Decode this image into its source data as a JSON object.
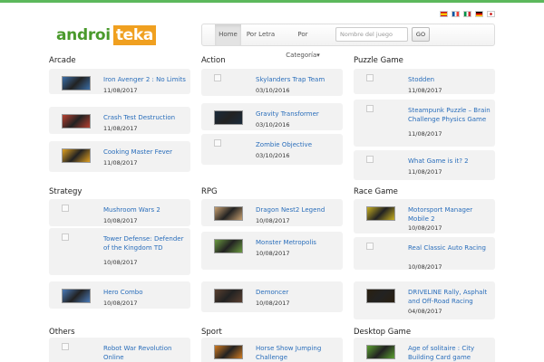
{
  "brand": {
    "part1": "androi",
    "part2": "teka"
  },
  "languages": [
    {
      "name": "Español",
      "icon": "flag-es-icon",
      "colors": [
        "#c60b1e",
        "#ffc400",
        "#c60b1e"
      ]
    },
    {
      "name": "Français",
      "icon": "flag-fr-icon",
      "colors": [
        "#0055a4",
        "#ffffff",
        "#ef4135"
      ]
    },
    {
      "name": "Italiano",
      "icon": "flag-it-icon",
      "colors": [
        "#009246",
        "#ffffff",
        "#ce2b37"
      ]
    },
    {
      "name": "Deutsch",
      "icon": "flag-de-icon",
      "colors": [
        "#000000",
        "#dd0000",
        "#ffce00"
      ]
    },
    {
      "name": "Other",
      "icon": "flag-other-icon",
      "colors": [
        "#ffffff",
        "#cc2222",
        "#ffffff"
      ]
    }
  ],
  "nav": {
    "home": "Home",
    "by_letter": "Por Letra",
    "by_category": "Por Categoría",
    "dropdown_caret": "▾",
    "search_placeholder": "Nombre del juego",
    "go": "GO"
  },
  "colors": {
    "accent_green": "#5cb85c",
    "link_blue": "#2a6ebb",
    "card_bg": "#f2f2f2"
  },
  "categories": [
    {
      "title": "Arcade",
      "games": [
        {
          "title": "Iron Avenger 2 : No Limits",
          "date": "11/08/2017",
          "thumb": "image"
        },
        {
          "title": "Crash Test Destruction",
          "date": "11/08/2017",
          "thumb": "image"
        },
        {
          "title": "Cooking Master Fever",
          "date": "11/08/2017",
          "thumb": "image"
        }
      ]
    },
    {
      "title": "Action",
      "games": [
        {
          "title": "Skylanders Trap Team",
          "date": "03/10/2016",
          "thumb": "broken"
        },
        {
          "title": "Gravity Transformer",
          "date": "03/10/2016",
          "thumb": "image"
        },
        {
          "title": "Zombie Objective",
          "date": "03/10/2016",
          "thumb": "broken"
        }
      ]
    },
    {
      "title": "Puzzle Game",
      "games": [
        {
          "title": "Stodden",
          "date": "11/08/2017",
          "thumb": "broken"
        },
        {
          "title": "Steampunk Puzzle – Brain Challenge Physics Game",
          "date": "11/08/2017",
          "thumb": "broken"
        },
        {
          "title": "What Game is it? 2",
          "date": "11/08/2017",
          "thumb": "broken"
        }
      ]
    },
    {
      "title": "Strategy",
      "games": [
        {
          "title": "Mushroom Wars 2",
          "date": "10/08/2017",
          "thumb": "broken"
        },
        {
          "title": "Tower Defense: Defender of the Kingdom TD",
          "date": "10/08/2017",
          "thumb": "broken"
        },
        {
          "title": "Hero Combo",
          "date": "10/08/2017",
          "thumb": "image"
        }
      ]
    },
    {
      "title": "RPG",
      "games": [
        {
          "title": "Dragon Nest2 Legend",
          "date": "10/08/2017",
          "thumb": "image"
        },
        {
          "title": "Monster Metropolis",
          "date": "10/08/2017",
          "thumb": "image"
        },
        {
          "title": "Demoncer",
          "date": "10/08/2017",
          "thumb": "image"
        }
      ]
    },
    {
      "title": "Race Game",
      "games": [
        {
          "title": "Motorsport Manager Mobile 2",
          "date": "10/08/2017",
          "thumb": "image"
        },
        {
          "title": "Real Classic Auto Racing",
          "date": "10/08/2017",
          "thumb": "broken"
        },
        {
          "title": "DRIVELINE Rally, Asphalt and Off-Road Racing",
          "date": "04/08/2017",
          "thumb": "image"
        }
      ]
    },
    {
      "title": "Others",
      "games": [
        {
          "title": "Robot War Revolution Online",
          "date": "",
          "thumb": "broken"
        }
      ]
    },
    {
      "title": "Sport",
      "games": [
        {
          "title": "Horse Show Jumping Challenge",
          "date": "",
          "thumb": "image"
        }
      ]
    },
    {
      "title": "Desktop Game",
      "games": [
        {
          "title": "Age of solitaire : City Building Card game",
          "date": "",
          "thumb": "image"
        }
      ]
    }
  ]
}
